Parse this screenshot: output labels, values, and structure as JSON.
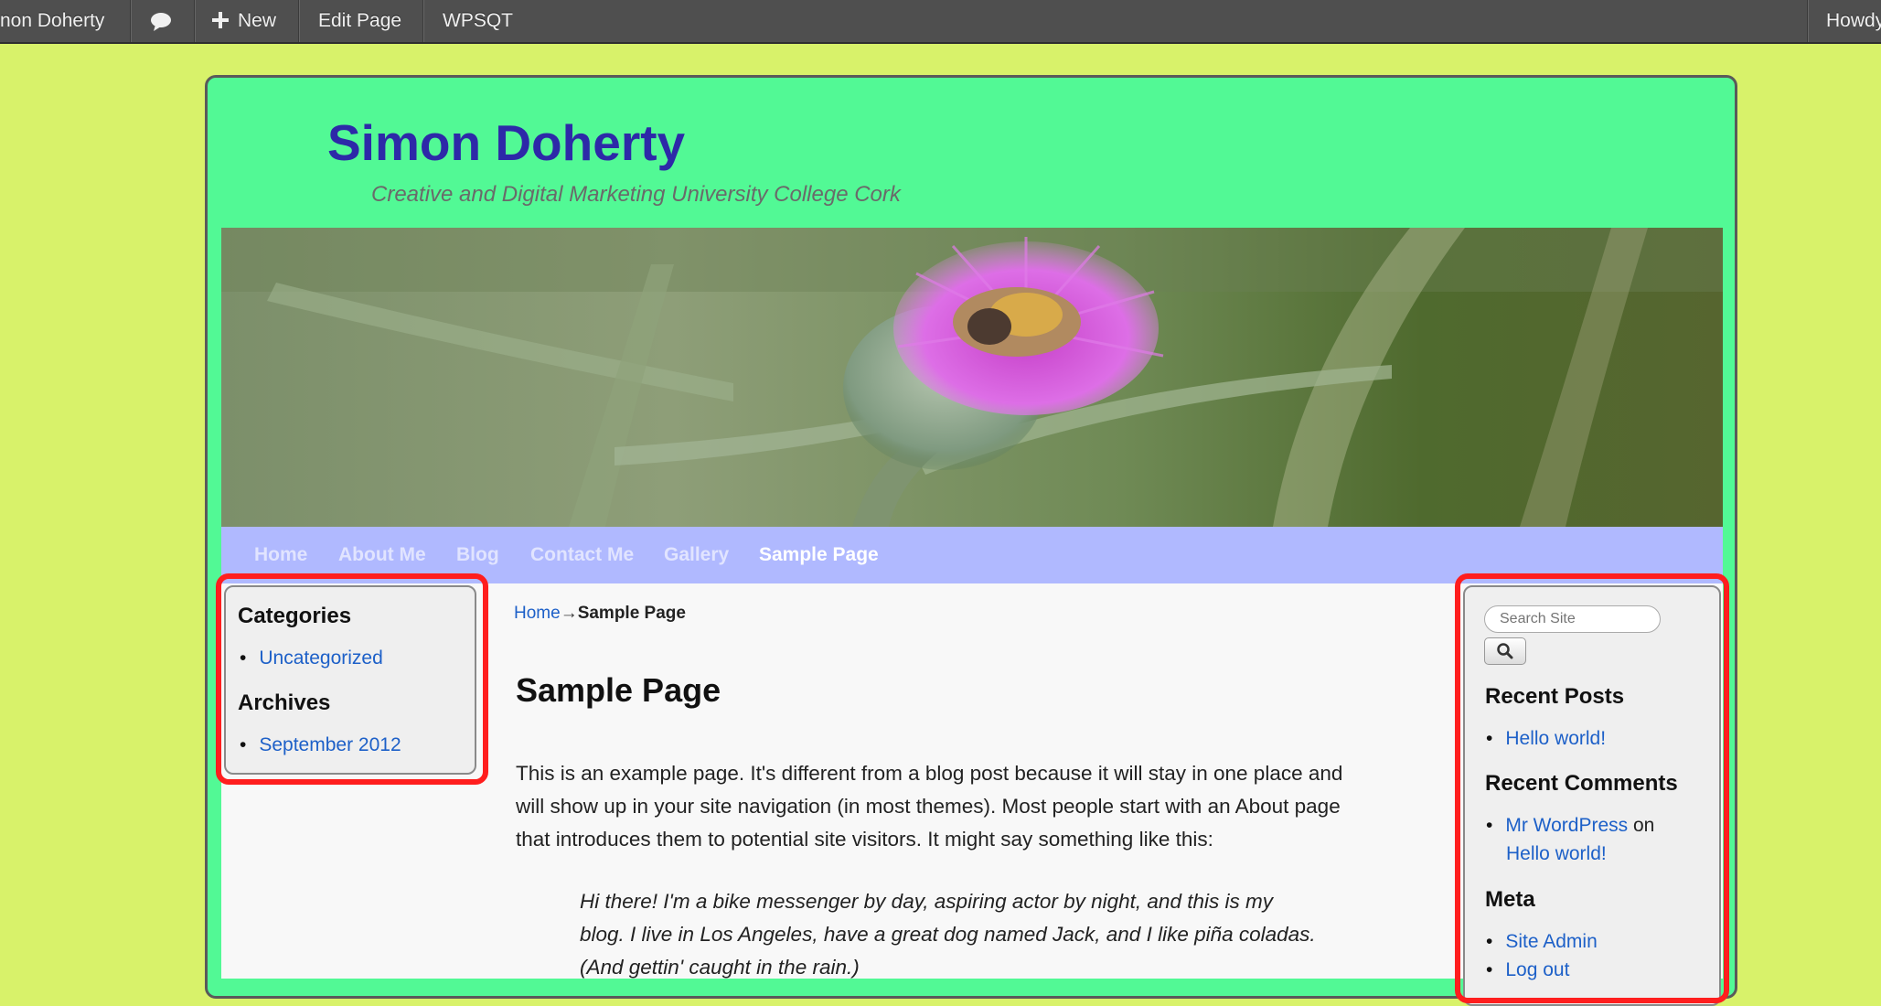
{
  "admin_bar": {
    "site_name": "non Doherty",
    "new_label": "New",
    "edit_page_label": "Edit Page",
    "plugin_label": "WPSQT",
    "howdy_label": "Howdy"
  },
  "site": {
    "title": "Simon Doherty",
    "description": "Creative and Digital Marketing University College Cork"
  },
  "nav": {
    "items": [
      "Home",
      "About Me",
      "Blog",
      "Contact Me",
      "Gallery",
      "Sample Page"
    ],
    "current": "Sample Page"
  },
  "left_sidebar": {
    "categories_title": "Categories",
    "categories": [
      "Uncategorized"
    ],
    "archives_title": "Archives",
    "archives": [
      "September 2012"
    ]
  },
  "breadcrumb": {
    "home": "Home",
    "separator": "→",
    "current": "Sample Page"
  },
  "main": {
    "title": "Sample Page",
    "lines": [
      "This is an example page. It's different from a blog post because it will stay in one place and",
      "will show up in your site navigation (in most themes). Most people start with an About page",
      "that introduces them to potential site visitors. It might say something like this:"
    ],
    "quote_lines": [
      "Hi there! I'm a bike messenger by day, aspiring actor by night, and this is my",
      "blog. I live in Los Angeles, have a great dog named Jack, and I like piña coladas.",
      "(And gettin' caught in the rain.)"
    ]
  },
  "right_sidebar": {
    "search_placeholder": "Search Site",
    "recent_posts_title": "Recent Posts",
    "recent_posts": [
      "Hello world!"
    ],
    "recent_comments_title": "Recent Comments",
    "comment_author": "Mr WordPress",
    "comment_on": "on",
    "comment_post": "Hello world!",
    "meta_title": "Meta",
    "meta_links": [
      "Site Admin",
      "Log out"
    ]
  },
  "colors": {
    "page_background": "#d8f26a",
    "card_background": "#52f995",
    "nav_background": "#b0b9ff",
    "title_color": "#2d29a8",
    "link_color": "#1d60c8",
    "highlight_border": "#ff1e1e"
  },
  "icons": [
    "comment-bubble-icon",
    "plus-icon",
    "search-icon"
  ]
}
